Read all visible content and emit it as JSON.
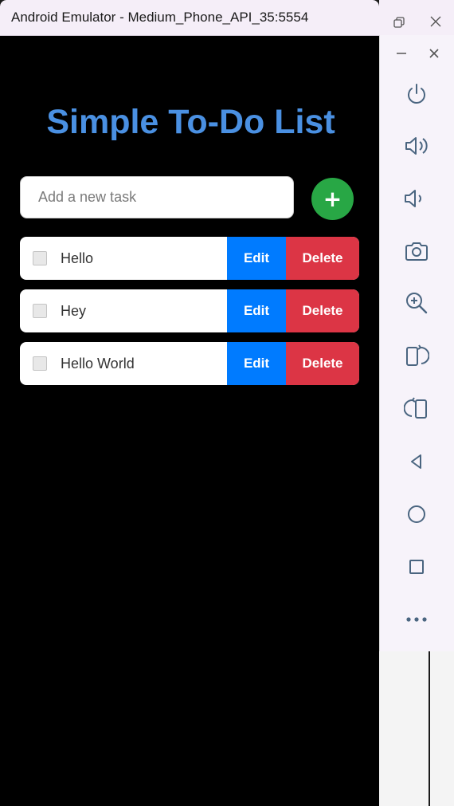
{
  "window": {
    "title": "Android Emulator - Medium_Phone_API_35:5554"
  },
  "app": {
    "title": "Simple To-Do List",
    "input": {
      "placeholder": "Add a new task",
      "value": ""
    },
    "add_label": "+",
    "tasks": [
      {
        "text": "Hello",
        "edit_label": "Edit",
        "delete_label": "Delete"
      },
      {
        "text": "Hey",
        "edit_label": "Edit",
        "delete_label": "Delete"
      },
      {
        "text": "Hello World",
        "edit_label": "Edit",
        "delete_label": "Delete"
      }
    ]
  },
  "colors": {
    "title": "#4a90e2",
    "add": "#28a745",
    "edit": "#007bff",
    "delete": "#dc3545"
  },
  "emulator_controls": [
    "restore-icon",
    "minimize-icon",
    "close-icon",
    "power-icon",
    "volume-up-icon",
    "volume-down-icon",
    "camera-icon",
    "zoom-in-icon",
    "rotate-left-icon",
    "rotate-right-icon",
    "back-icon",
    "home-icon",
    "overview-icon",
    "more-icon"
  ]
}
